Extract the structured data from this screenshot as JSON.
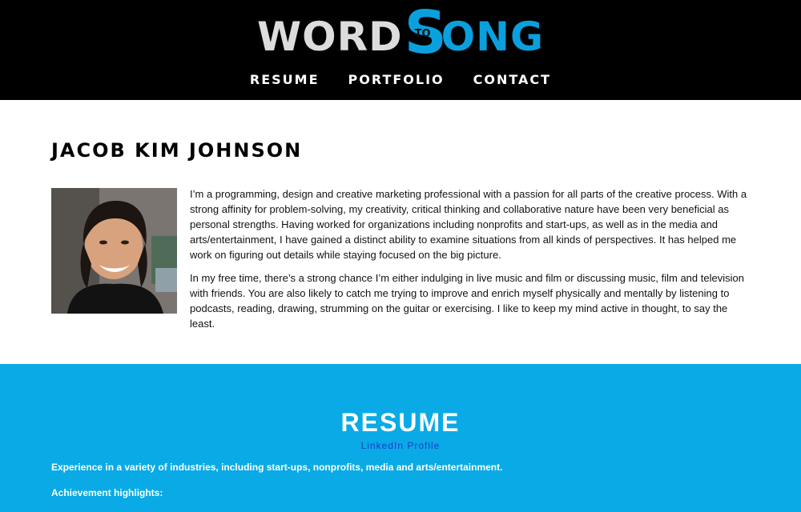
{
  "header": {
    "logo": {
      "left": "WORD",
      "to": "TO",
      "s": "S",
      "right": "ONG"
    },
    "nav": [
      {
        "label": "RESUME"
      },
      {
        "label": "PORTFOLIO"
      },
      {
        "label": "CONTACT"
      }
    ]
  },
  "about": {
    "name": "JACOB KIM JOHNSON",
    "photo_alt": "Photo of Jacob Kim Johnson",
    "bio": [
      "I’m a programming, design and creative marketing professional with a passion for all parts of the creative process. With a strong affinity for problem-solving, my creativity, critical thinking and collaborative nature have been very beneficial as personal strengths. Having worked for organizations including nonprofits and start-ups, as well as in the media and arts/entertainment, I have gained a distinct ability to examine situations from all kinds of perspectives. It has helped me work on figuring out details while staying focused on the big picture.",
      "In my free time, there’s a strong chance I’m either indulging in live music and film or discussing music, film and television with friends. You are also likely to catch me trying to improve and enrich myself physically and mentally by listening to podcasts, reading, drawing, strumming on the guitar or exercising. I like to keep my mind active in thought, to say the least."
    ]
  },
  "resume": {
    "title": "RESUME",
    "link": "LinkedIn Profile",
    "experience": "Experience in a variety of industries, including start-ups, nonprofits, media and arts/entertainment.",
    "achievements": "Achievement highlights:"
  },
  "colors": {
    "brand_blue": "#0aaae6",
    "header_bg": "#000000",
    "link_blue": "#1b3ccf"
  }
}
